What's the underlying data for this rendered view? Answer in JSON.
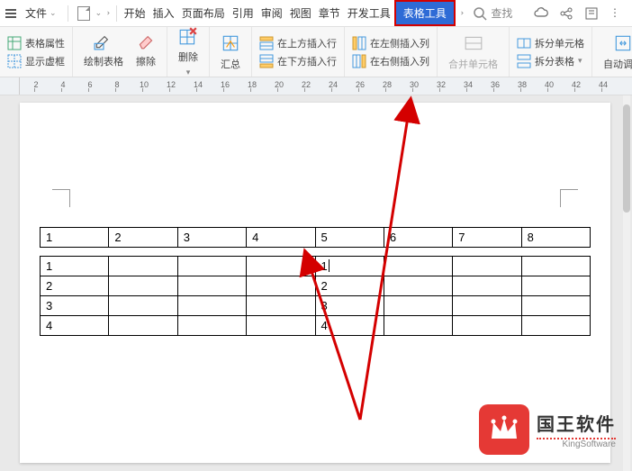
{
  "menubar": {
    "file_label": "文件",
    "tabs": [
      "开始",
      "插入",
      "页面布局",
      "引用",
      "审阅",
      "视图",
      "章节",
      "开发工具",
      "表格工具"
    ],
    "highlighted_tab_index": 8,
    "search_label": "查找"
  },
  "ribbon": {
    "g1": {
      "props": "表格属性",
      "show_grid": "显示虚框"
    },
    "g2": {
      "draw": "绘制表格",
      "erase": "擦除"
    },
    "g3": {
      "delete": "删除"
    },
    "g4": {
      "summary": "汇总"
    },
    "g5": {
      "ins_above": "在上方插入行",
      "ins_below": "在下方插入行"
    },
    "g6": {
      "ins_left": "在左侧插入列",
      "ins_right": "在右侧插入列"
    },
    "g7": {
      "merge": "合并单元格"
    },
    "g8": {
      "split_cell": "拆分单元格",
      "split_table": "拆分表格"
    },
    "g9": {
      "autofit": "自动调整"
    }
  },
  "ruler": {
    "ticks": [
      2,
      4,
      6,
      8,
      10,
      12,
      14,
      16,
      18,
      20,
      22,
      24,
      26,
      28,
      30,
      32,
      34,
      36,
      38,
      40,
      42,
      44
    ]
  },
  "table": {
    "header": [
      "1",
      "2",
      "3",
      "4",
      "5",
      "6",
      "7",
      "8"
    ],
    "rows": [
      [
        "1",
        "",
        "",
        "",
        "1",
        "",
        "",
        ""
      ],
      [
        "2",
        "",
        "",
        "",
        "2",
        "",
        "",
        ""
      ],
      [
        "3",
        "",
        "",
        "",
        "3",
        "",
        "",
        ""
      ],
      [
        "4",
        "",
        "",
        "",
        "4",
        "",
        "",
        ""
      ]
    ],
    "cursor": {
      "row": 0,
      "col": 4
    }
  },
  "watermark": {
    "cn": "国王软件",
    "en": "KingSoftware"
  }
}
